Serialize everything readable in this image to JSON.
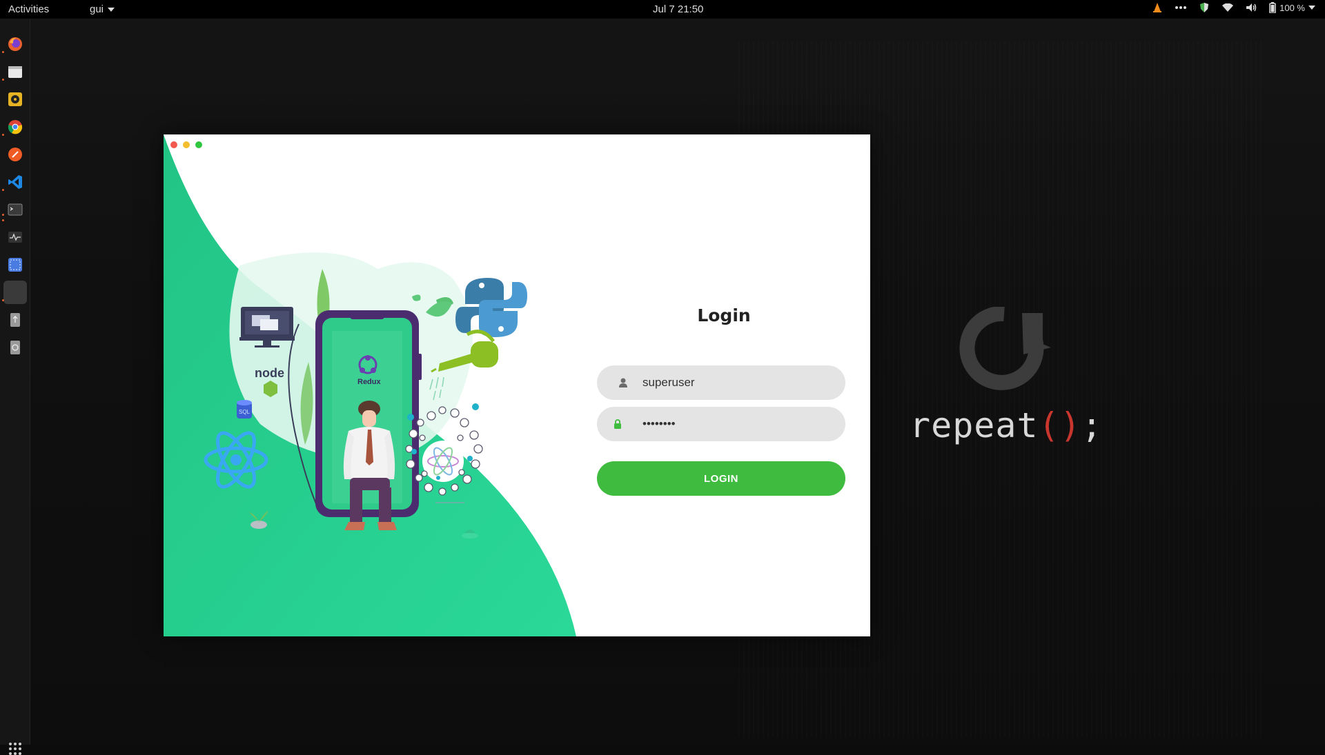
{
  "topbar": {
    "activities": "Activities",
    "app_menu": "gui",
    "clock": "Jul 7  21:50",
    "battery": "100 %"
  },
  "dock": {
    "items": [
      {
        "name": "firefox-icon"
      },
      {
        "name": "files-icon"
      },
      {
        "name": "rhythmbox-icon"
      },
      {
        "name": "chrome-icon"
      },
      {
        "name": "postman-icon"
      },
      {
        "name": "vscode-icon"
      },
      {
        "name": "terminal-icon"
      },
      {
        "name": "system-monitor-icon"
      },
      {
        "name": "screenshot-icon"
      },
      {
        "name": "active-app-icon"
      },
      {
        "name": "usb-drive-icon"
      },
      {
        "name": "disk-icon"
      }
    ]
  },
  "wallpaper": {
    "code_text": "repeat",
    "open_paren": "(",
    "close_paren": ")",
    "semicolon": ";"
  },
  "app_window": {
    "illustration": {
      "phone_label": "Redux",
      "node_label": "node",
      "db_label": "SQL"
    },
    "login": {
      "title": "Login",
      "username_value": "superuser",
      "password_value": "********",
      "button_label": "LOGIN"
    }
  },
  "colors": {
    "accent_green": "#3fbb3f",
    "illustration_green": "#26d08b",
    "field_bg": "#e4e4e4"
  }
}
